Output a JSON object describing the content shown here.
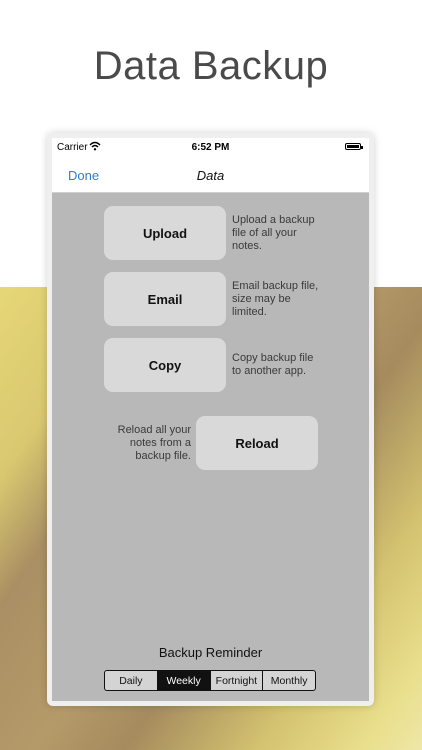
{
  "headline": "Data Backup",
  "status": {
    "carrier": "Carrier",
    "time": "6:52 PM"
  },
  "nav": {
    "done": "Done",
    "title": "Data"
  },
  "actions": [
    {
      "label": "Upload",
      "description": "Upload a backup file of all your notes."
    },
    {
      "label": "Email",
      "description": "Email backup file, size may be limited."
    },
    {
      "label": "Copy",
      "description": "Copy backup file to another app."
    }
  ],
  "reload": {
    "label": "Reload",
    "description": "Reload all your notes from a backup file."
  },
  "reminder": {
    "label": "Backup Reminder",
    "options": [
      "Daily",
      "Weekly",
      "Fortnight",
      "Monthly"
    ],
    "selected": "Weekly"
  }
}
